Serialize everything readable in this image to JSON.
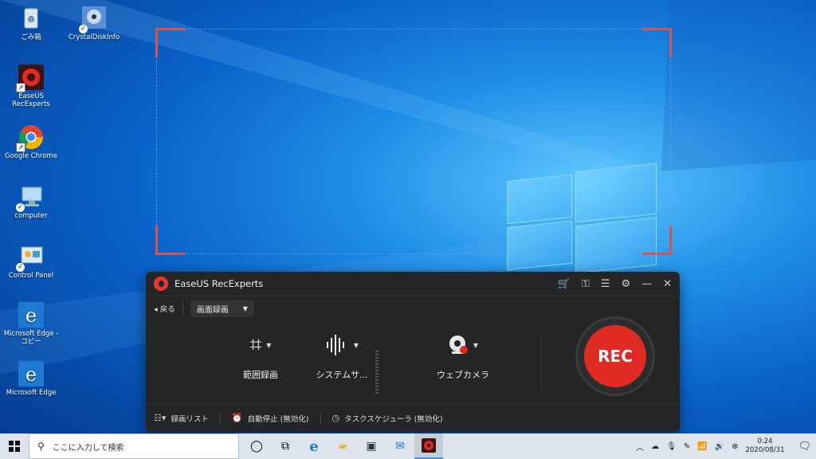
{
  "desktop": {
    "icons": [
      {
        "label": "ごみ箱"
      },
      {
        "label": "CrystalDiskInfo"
      },
      {
        "label": "EaseUS RecExperts"
      },
      {
        "label": "Google Chrome"
      },
      {
        "label": "computer"
      },
      {
        "label": "Control Panel"
      },
      {
        "label": "Microsoft Edge - コピー"
      },
      {
        "label": "Microsoft Edge"
      }
    ]
  },
  "recorder": {
    "app_name": "EaseUS RecExperts",
    "back_label": "◂ 戻る",
    "mode_label": "画面録画",
    "mode_caret": "▼",
    "tools": [
      {
        "label": "範囲録画"
      },
      {
        "label": "システムサ..."
      },
      {
        "label": "ウェブカメラ"
      }
    ],
    "rec_label": "REC",
    "footer": {
      "recordings": "録画リスト",
      "auto_stop": "自動停止 (無効化)",
      "scheduler": "タスクスケジューラ (無効化)"
    }
  },
  "taskbar": {
    "search_placeholder": "ここに入力して検索",
    "time": "0:24",
    "date": "2020/08/31"
  },
  "colors": {
    "accent_red": "#e02a24",
    "window_bg": "#242526",
    "region_corner": "#d9534f"
  }
}
